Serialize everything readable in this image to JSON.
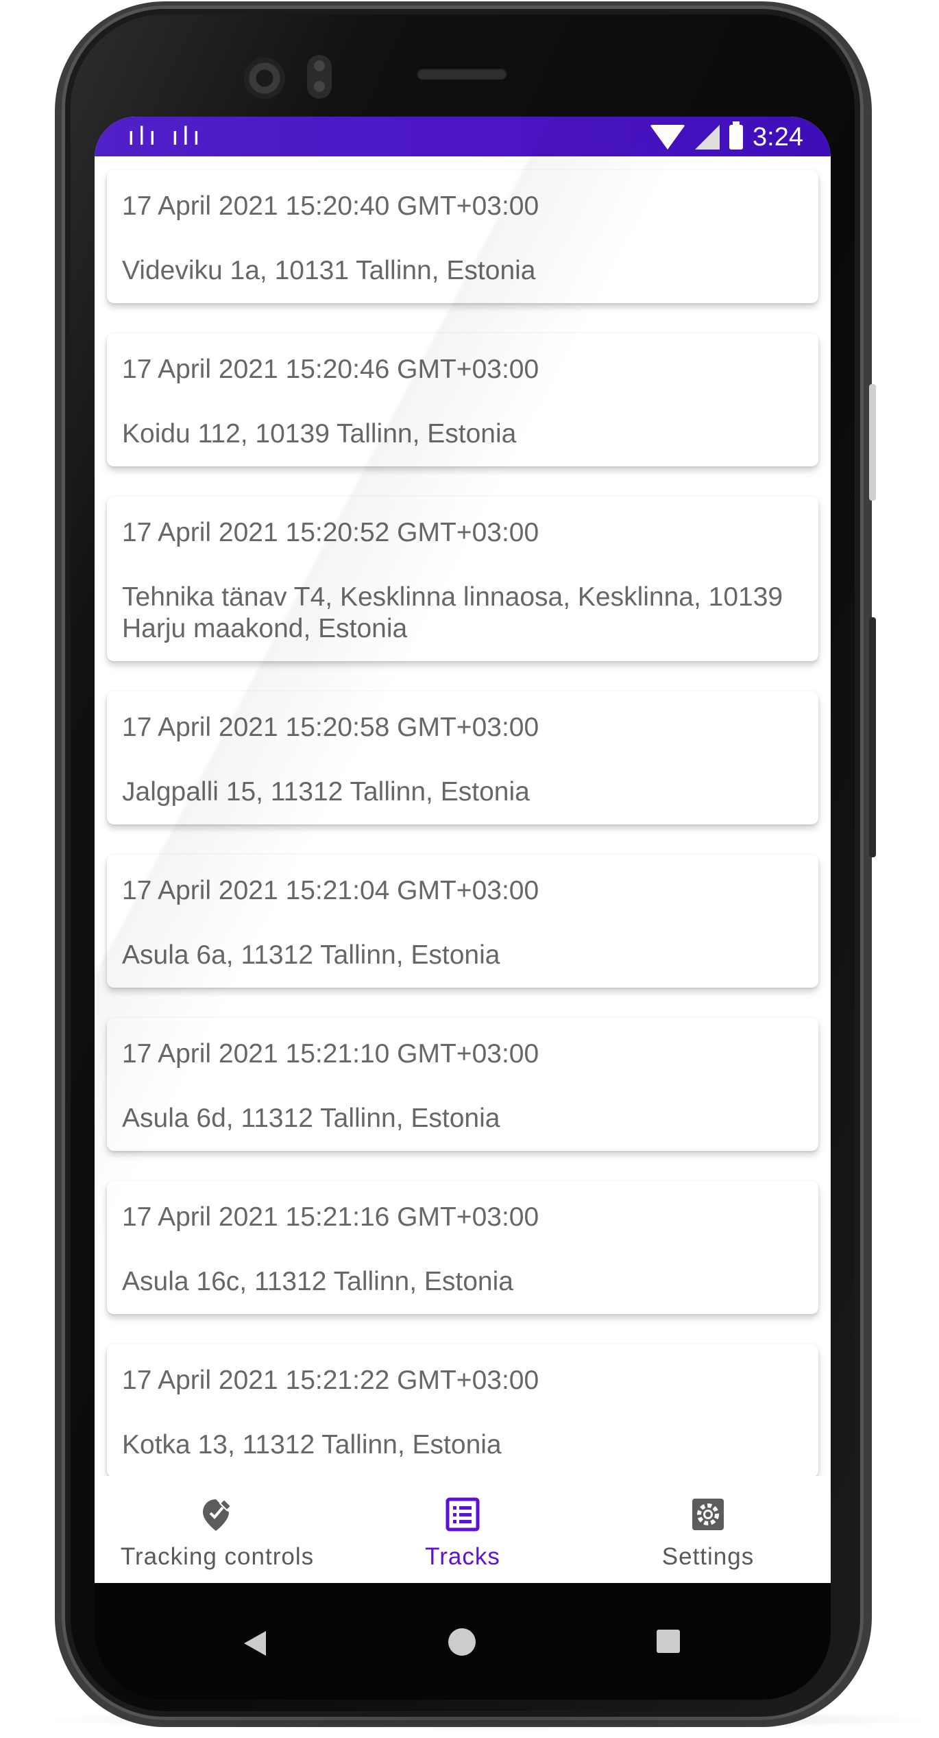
{
  "status_bar": {
    "left_icons": "ılı ılı",
    "time": "3:24",
    "wifi_icon": "wifi-icon",
    "signal_icon": "cell-signal-icon",
    "battery_icon": "battery-icon"
  },
  "tracks": [
    {
      "date": "17 April 2021 15:20:40 GMT+03:00",
      "address": "Videviku 1a, 10131 Tallinn, Estonia"
    },
    {
      "date": "17 April 2021 15:20:46 GMT+03:00",
      "address": "Koidu 112, 10139 Tallinn, Estonia"
    },
    {
      "date": "17 April 2021 15:20:52 GMT+03:00",
      "address": "Tehnika tänav T4, Kesklinna linnaosa, Kesklinna, 10139 Harju maakond, Estonia"
    },
    {
      "date": "17 April 2021 15:20:58 GMT+03:00",
      "address": "Jalgpalli 15, 11312 Tallinn, Estonia"
    },
    {
      "date": "17 April 2021 15:21:04 GMT+03:00",
      "address": "Asula 6a, 11312 Tallinn, Estonia"
    },
    {
      "date": "17 April 2021 15:21:10 GMT+03:00",
      "address": "Asula 6d, 11312 Tallinn, Estonia"
    },
    {
      "date": "17 April 2021 15:21:16 GMT+03:00",
      "address": "Asula 16c, 11312 Tallinn, Estonia"
    },
    {
      "date": "17 April 2021 15:21:22 GMT+03:00",
      "address": "Kotka 13, 11312 Tallinn, Estonia"
    }
  ],
  "bottom_nav": {
    "items": [
      {
        "label": "Tracking controls",
        "icon": "location-edit-icon",
        "active": false
      },
      {
        "label": "Tracks",
        "icon": "list-icon",
        "active": true
      },
      {
        "label": "Settings",
        "icon": "gear-icon",
        "active": false
      }
    ]
  },
  "colors": {
    "accent": "#5b12d6",
    "status_bar": "#4b13c4",
    "text_secondary": "#676767"
  }
}
